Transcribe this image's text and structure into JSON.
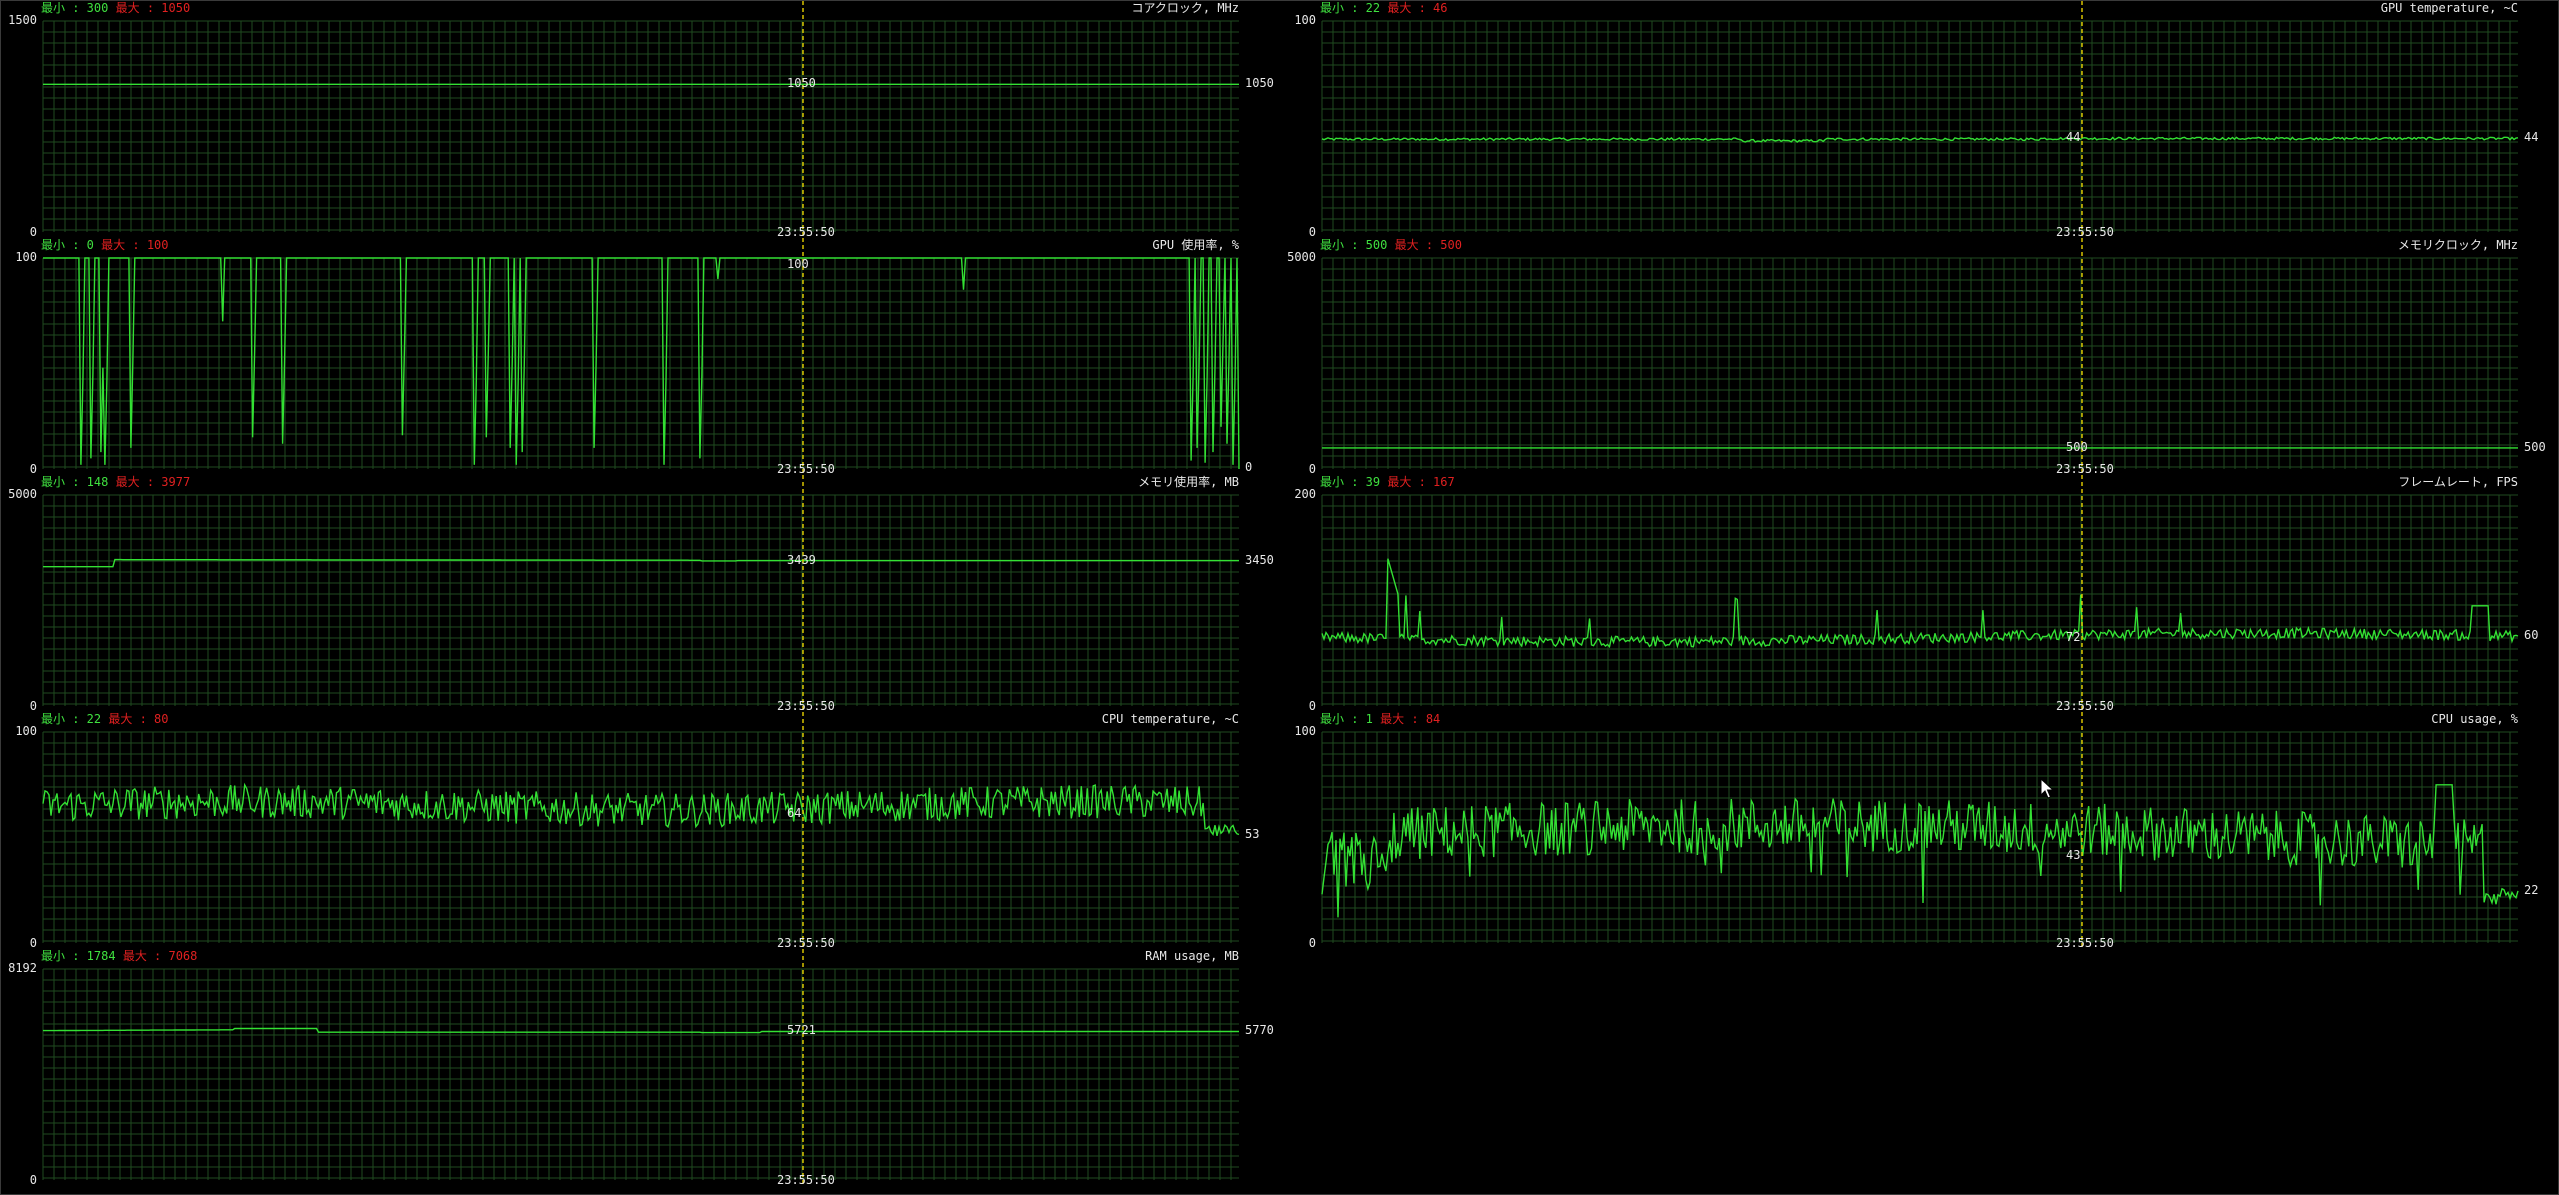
{
  "window": {
    "title": ""
  },
  "colors": {
    "grid": "#1f4a1f",
    "line": "#33e033",
    "cursor_line": "#e8d000",
    "min": "#3fe03f",
    "max": "#e02020"
  },
  "icons": {
    "cursor": "mouse-pointer-icon"
  },
  "graphs": [
    {
      "id": "core-clock",
      "title": "コアクロック, MHz",
      "min_label": "最小 : 300",
      "max_label": "最大 : 1050",
      "y_max_label": "1500",
      "y_min_label": "0",
      "ymax": 1500,
      "time": "23:55:50",
      "cursor_value": "1050",
      "current_value": "1050",
      "kind": "flat",
      "level": 1050
    },
    {
      "id": "gpu-temperature",
      "title": "GPU temperature, ~C",
      "min_label": "最小 : 22",
      "max_label": "最大 : 46",
      "y_max_label": "100",
      "y_min_label": "0",
      "ymax": 100,
      "time": "23:55:50",
      "cursor_value": "44",
      "current_value": "44",
      "kind": "noise",
      "level": 44,
      "amp": 0.6
    },
    {
      "id": "gpu-usage",
      "title": "GPU 使用率, %",
      "min_label": "最小 : 0",
      "max_label": "最大 : 100",
      "y_max_label": "100",
      "y_min_label": "0",
      "ymax": 100,
      "time": "23:55:50",
      "cursor_value": "100",
      "current_value": "0",
      "kind": "gpu",
      "level": 100
    },
    {
      "id": "memory-clock",
      "title": "メモリクロック, MHz",
      "min_label": "最小 : 500",
      "max_label": "最大 : 500",
      "y_max_label": "5000",
      "y_min_label": "0",
      "ymax": 5000,
      "time": "23:55:50",
      "cursor_value": "500",
      "current_value": "500",
      "kind": "flat",
      "level": 500
    },
    {
      "id": "memory-usage",
      "title": "メモリ使用率, MB",
      "min_label": "最小 : 148",
      "max_label": "最大 : 3977",
      "y_max_label": "5000",
      "y_min_label": "0",
      "ymax": 5000,
      "time": "23:55:50",
      "cursor_value": "3439",
      "current_value": "3450",
      "kind": "mem",
      "level": 3450
    },
    {
      "id": "framerate",
      "title": "フレームレート, FPS",
      "min_label": "最小 : 39",
      "max_label": "最大 : 167",
      "y_max_label": "200",
      "y_min_label": "0",
      "ymax": 200,
      "time": "23:55:50",
      "cursor_value": "72",
      "current_value": "60",
      "kind": "fps",
      "level": 65
    },
    {
      "id": "cpu-temperature",
      "title": "CPU temperature, ~C",
      "min_label": "最小 : 22",
      "max_label": "最大 : 80",
      "y_max_label": "100",
      "y_min_label": "0",
      "ymax": 100,
      "time": "23:55:50",
      "cursor_value": "64",
      "current_value": "53",
      "kind": "cputemp",
      "level": 65
    },
    {
      "id": "cpu-usage",
      "title": "CPU usage, %",
      "min_label": "最小 : 1",
      "max_label": "最大 : 84",
      "y_max_label": "100",
      "y_min_label": "0",
      "ymax": 100,
      "time": "23:55:50",
      "cursor_value": "43",
      "current_value": "22",
      "kind": "cpuuse",
      "level": 48
    },
    {
      "id": "ram-usage",
      "title": "RAM usage, MB",
      "min_label": "最小 : 1784",
      "max_label": "最大 : 7068",
      "y_max_label": "8192",
      "y_min_label": "0",
      "ymax": 8192,
      "time": "23:55:50",
      "cursor_value": "5721",
      "current_value": "5770",
      "kind": "ram",
      "level": 5770
    }
  ]
}
